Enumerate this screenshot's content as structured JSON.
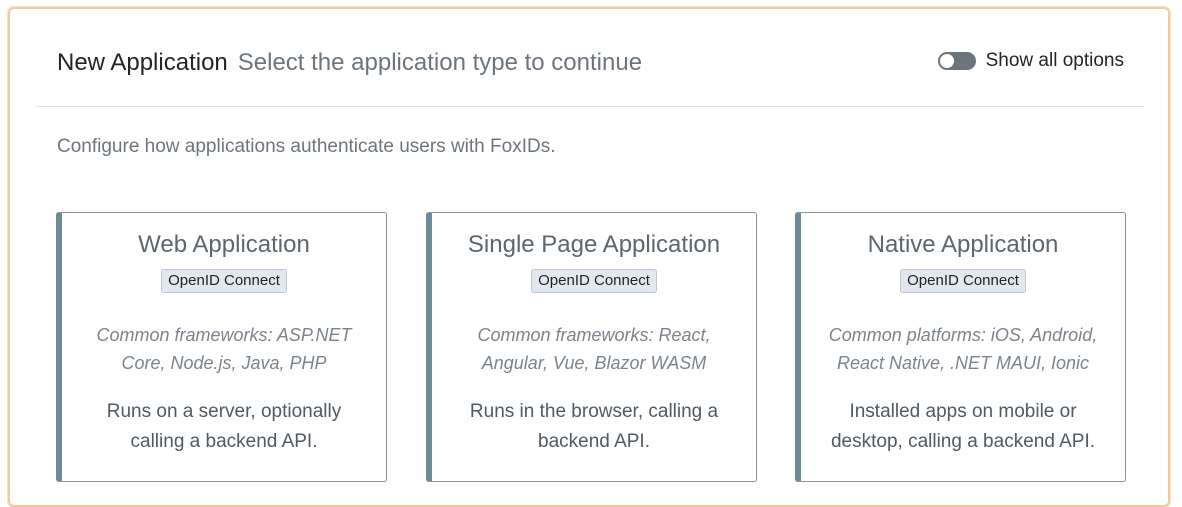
{
  "header": {
    "title": "New Application",
    "subtitle": "Select the application type to continue",
    "toggle_label": "Show all options",
    "toggle_on": false
  },
  "intro": "Configure how applications authenticate users with FoxIDs.",
  "cards": [
    {
      "title": "Web Application",
      "badge": "OpenID Connect",
      "frameworks": "Common frameworks: ASP.NET Core, Node.js, Java, PHP",
      "description": "Runs on a server, optionally calling a backend API."
    },
    {
      "title": "Single Page Application",
      "badge": "OpenID Connect",
      "frameworks": "Common frameworks: React, Angular, Vue, Blazor WASM",
      "description": "Runs in the browser, calling a backend API."
    },
    {
      "title": "Native Application",
      "badge": "OpenID Connect",
      "frameworks": "Common platforms: iOS, Android, React Native, .NET MAUI, Ionic",
      "description": "Installed apps on mobile or desktop, calling a backend API."
    }
  ],
  "colors": {
    "dialog_border": "#f6c99a",
    "card_accent": "#6d8b96",
    "toggle_off": "#6c757d"
  }
}
